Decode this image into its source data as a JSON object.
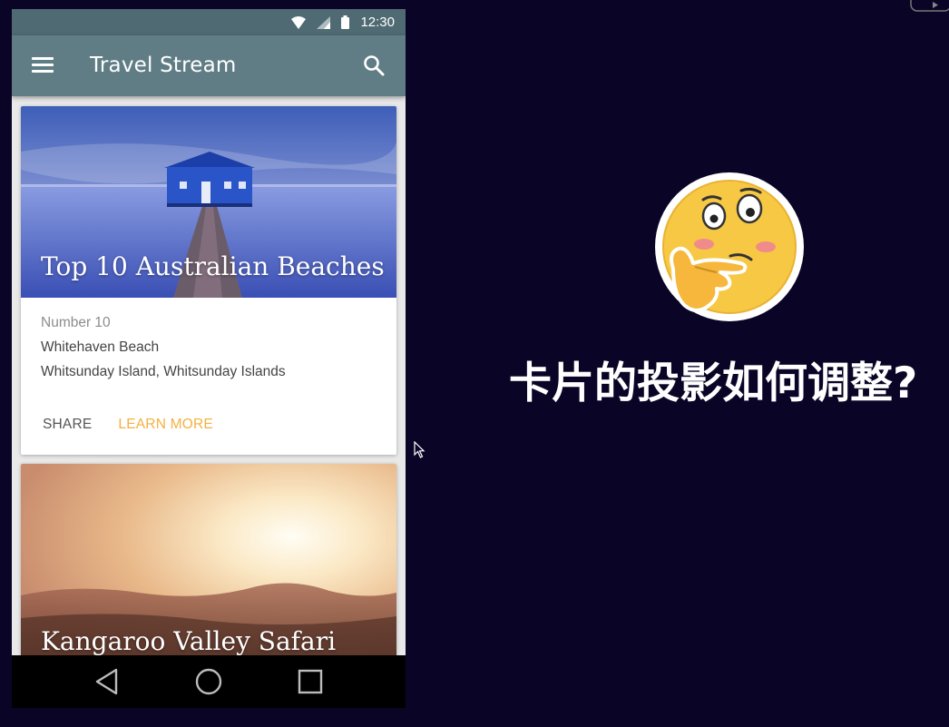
{
  "status_bar": {
    "time": "12:30"
  },
  "app_bar": {
    "title": "Travel Stream"
  },
  "cards": [
    {
      "title": "Top 10 Australian Beaches",
      "subhead": "Number 10",
      "line1": "Whitehaven Beach",
      "line2": "Whitsunday Island, Whitsunday Islands",
      "actions": {
        "share": "SHARE",
        "learn_more": "LEARN MORE"
      }
    },
    {
      "title": "Kangaroo Valley Safari"
    }
  ],
  "caption": {
    "text": "卡片的投影如何调整?"
  },
  "colors": {
    "app_bar": "#607d86",
    "status_bar": "#4f6a72",
    "accent": "#f5b041",
    "background": "#0a0526"
  }
}
